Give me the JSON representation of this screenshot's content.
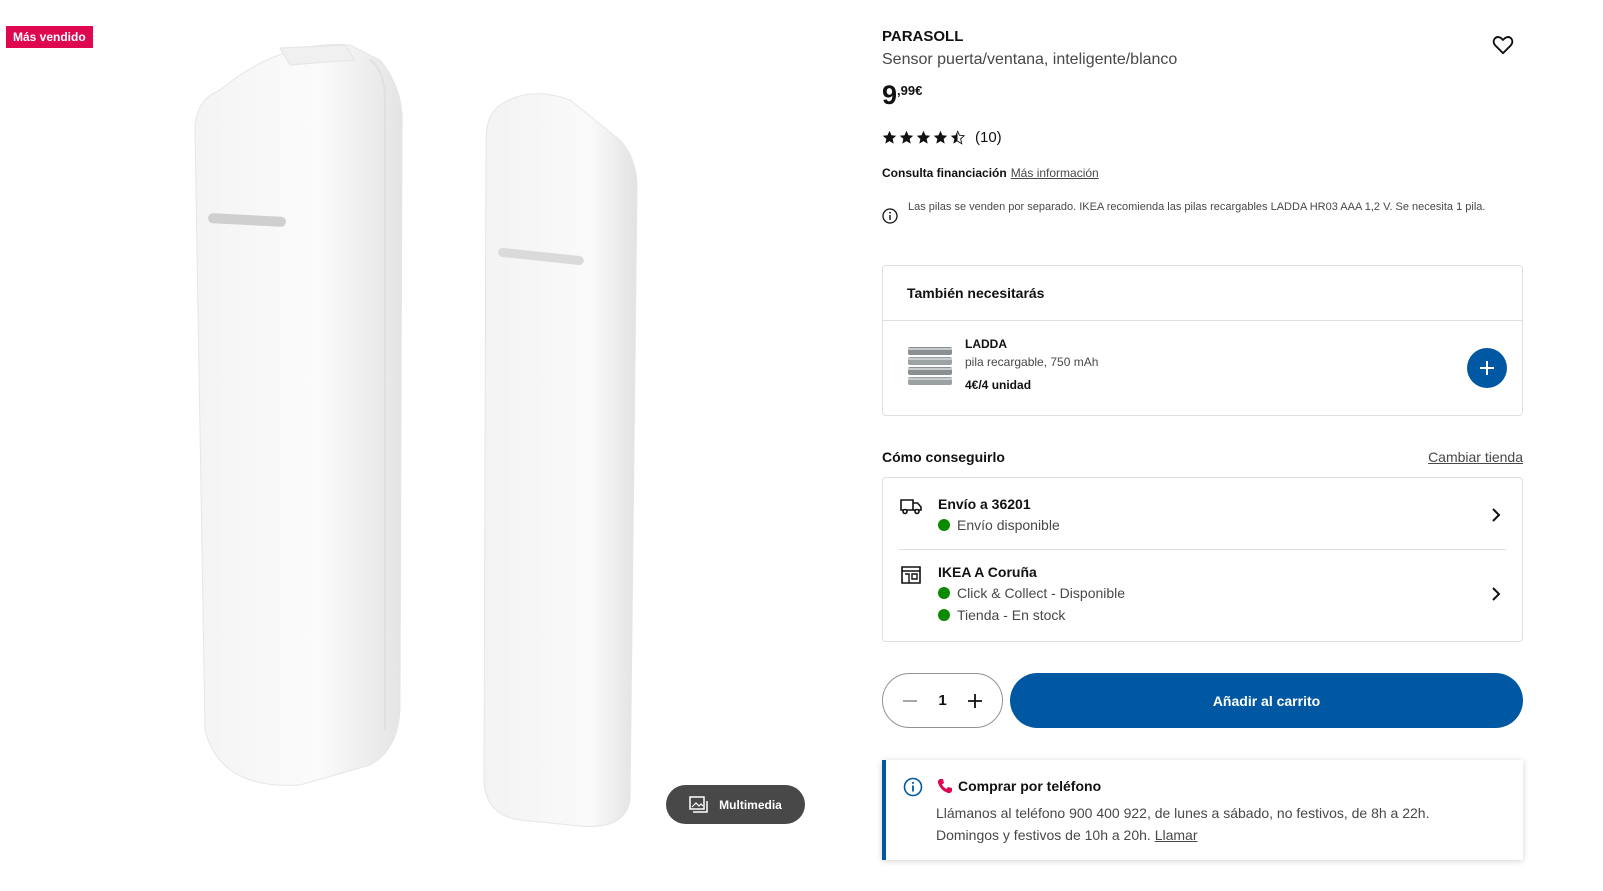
{
  "badge": "Más vendido",
  "media_button": "Multimedia",
  "product": {
    "name": "PARASOLL",
    "description": "Sensor puerta/ventana, inteligente/blanco",
    "price_int": "9",
    "price_dec": ",99€",
    "rating_value": 4.5,
    "rating_count": "(10)"
  },
  "finance": {
    "label": "Consulta financiación",
    "link": "Más información"
  },
  "notice": "Las pilas se venden por separado. IKEA recomienda las pilas recargables LADDA HR03 AAA 1,2 V. Se necesita 1 pila.",
  "also_need": {
    "title": "También necesitarás",
    "item_name": "LADDA",
    "item_desc": "pila recargable, 750 mAh",
    "item_price": "4€/4 unidad"
  },
  "how_to_get": {
    "title": "Cómo conseguirlo",
    "change_store": "Cambiar tienda",
    "delivery_title": "Envío a 36201",
    "delivery_status": "Envío disponible",
    "store_title": "IKEA A Coruña",
    "store_status_1": "Click & Collect - Disponible",
    "store_status_2": "Tienda - En stock"
  },
  "quantity": "1",
  "add_to_cart": "Añadir al carrito",
  "phone": {
    "title": "Comprar por teléfono",
    "text": "Llámanos al teléfono 900 400 922, de lunes a sábado, no festivos, de 8h a 22h. Domingos y festivos de 10h a 20h.",
    "link": "Llamar"
  },
  "colors": {
    "brand_blue": "#0058a3",
    "badge_red": "#e00751",
    "available_green": "#0a8a00"
  }
}
